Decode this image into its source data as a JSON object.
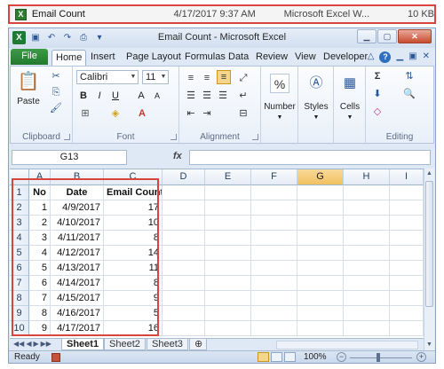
{
  "file_listing": {
    "name": "Email Count",
    "modified": "4/17/2017 9:37 AM",
    "type": "Microsoft Excel W...",
    "size": "10 KB"
  },
  "window": {
    "title": "Email Count - Microsoft Excel",
    "app_icon": "excel-logo",
    "buttons": [
      "minimize",
      "maximize",
      "close"
    ]
  },
  "tabs": [
    "File",
    "Home",
    "Insert",
    "Page Layout",
    "Formulas",
    "Data",
    "Review",
    "View",
    "Developer"
  ],
  "active_tab": "Home",
  "ribbon": {
    "clipboard": {
      "paste_label": "Paste",
      "group_label": "Clipboard"
    },
    "font": {
      "font_name": "Calibri",
      "font_size": "11",
      "group_label": "Font"
    },
    "alignment": {
      "group_label": "Alignment"
    },
    "number": {
      "label": "Number",
      "symbol": "%"
    },
    "styles": {
      "label": "Styles"
    },
    "cells": {
      "label": "Cells"
    },
    "editing": {
      "group_label": "Editing"
    }
  },
  "formula_bar": {
    "name_box": "G13",
    "fx_label": "fx",
    "value": ""
  },
  "columns": [
    "A",
    "B",
    "C",
    "D",
    "E",
    "F",
    "G",
    "H",
    "I"
  ],
  "selected_column": "G",
  "rows": [
    {
      "num": "1",
      "a": "No",
      "b": "Date",
      "c": "Email Count"
    },
    {
      "num": "2",
      "a": "1",
      "b": "4/9/2017",
      "c": "17"
    },
    {
      "num": "3",
      "a": "2",
      "b": "4/10/2017",
      "c": "10"
    },
    {
      "num": "4",
      "a": "3",
      "b": "4/11/2017",
      "c": "8"
    },
    {
      "num": "5",
      "a": "4",
      "b": "4/12/2017",
      "c": "14"
    },
    {
      "num": "6",
      "a": "5",
      "b": "4/13/2017",
      "c": "11"
    },
    {
      "num": "7",
      "a": "6",
      "b": "4/14/2017",
      "c": "8"
    },
    {
      "num": "8",
      "a": "7",
      "b": "4/15/2017",
      "c": "9"
    },
    {
      "num": "9",
      "a": "8",
      "b": "4/16/2017",
      "c": "5"
    },
    {
      "num": "10",
      "a": "9",
      "b": "4/17/2017",
      "c": "16"
    }
  ],
  "sheets": [
    "Sheet1",
    "Sheet2",
    "Sheet3"
  ],
  "active_sheet": "Sheet1",
  "status": {
    "ready": "Ready",
    "zoom": "100%"
  }
}
